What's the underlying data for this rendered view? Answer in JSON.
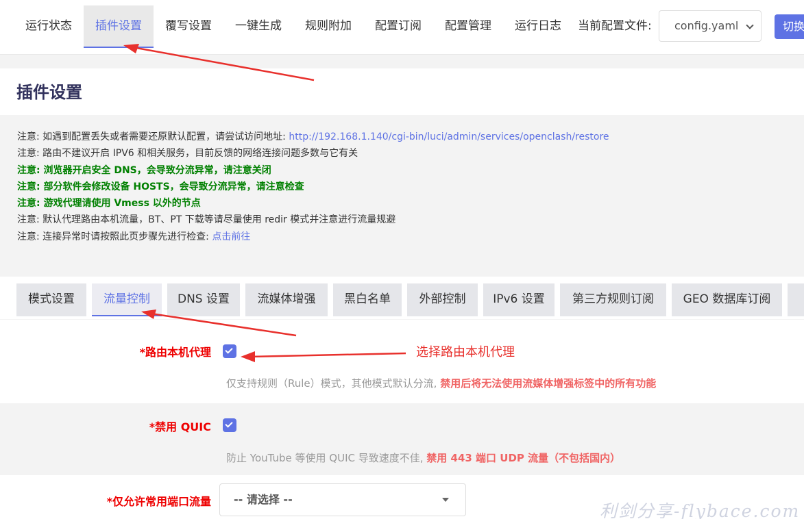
{
  "nav": {
    "items": [
      {
        "label": "运行状态",
        "active": false
      },
      {
        "label": "插件设置",
        "active": true
      },
      {
        "label": "覆写设置",
        "active": false
      },
      {
        "label": "一键生成",
        "active": false
      },
      {
        "label": "规则附加",
        "active": false
      },
      {
        "label": "配置订阅",
        "active": false
      },
      {
        "label": "配置管理",
        "active": false
      },
      {
        "label": "运行日志",
        "active": false
      }
    ],
    "config_label": "当前配置文件:",
    "config_value": "config.yaml",
    "switch_label": "切换"
  },
  "page_title": "插件设置",
  "notes": {
    "n1_text": "注意: 如遇到配置丢失或者需要还原默认配置，请尝试访问地址: ",
    "n1_link": "http://192.168.1.140/cgi-bin/luci/admin/services/openclash/restore",
    "n2": "注意: 路由不建议开启 IPV6 和相关服务，目前反馈的网络连接问题多数与它有关",
    "n3": "注意: 浏览器开启安全 DNS，会导致分流异常，请注意关闭",
    "n4": "注意: 部分软件会修改设备 HOSTS，会导致分流异常，请注意检查",
    "n5": "注意: 游戏代理请使用 Vmess 以外的节点",
    "n6": "注意: 默认代理路由本机流量，BT、PT 下载等请尽量使用 redir 模式并注意进行流量规避",
    "n7_text": "注意: 连接异常时请按照此页步骤先进行检查: ",
    "n7_link": "点击前往"
  },
  "tabs": [
    {
      "label": "模式设置",
      "active": false
    },
    {
      "label": "流量控制",
      "active": true
    },
    {
      "label": "DNS 设置",
      "active": false
    },
    {
      "label": "流媒体增强",
      "active": false
    },
    {
      "label": "黑白名单",
      "active": false
    },
    {
      "label": "外部控制",
      "active": false
    },
    {
      "label": "IPv6 设置",
      "active": false
    },
    {
      "label": "第三方规则订阅",
      "active": false
    },
    {
      "label": "GEO 数据库订阅",
      "active": false
    }
  ],
  "fields": {
    "route_local": {
      "label": "*路由本机代理",
      "checked": true,
      "desc": "仅支持规则（Rule）模式，其他模式默认分流, ",
      "desc_warn": "禁用后将无法使用流媒体增强标签中的所有功能"
    },
    "disable_quic": {
      "label": "*禁用 QUIC",
      "checked": true,
      "desc": "防止 YouTube 等使用 QUIC 导致速度不佳, ",
      "desc_warn": "禁用 443 端口 UDP 流量（不包括国内）"
    },
    "common_ports": {
      "label": "*仅允许常用端口流量",
      "value": "-- 请选择 --"
    }
  },
  "annotation": "选择路由本机代理",
  "watermark": "利剑分享-flybace.com",
  "colors": {
    "accent": "#5e72e4",
    "required_label": "#e00000",
    "warn_text": "#f06464",
    "note_green": "#008000",
    "annotation_red": "#e8302c"
  }
}
